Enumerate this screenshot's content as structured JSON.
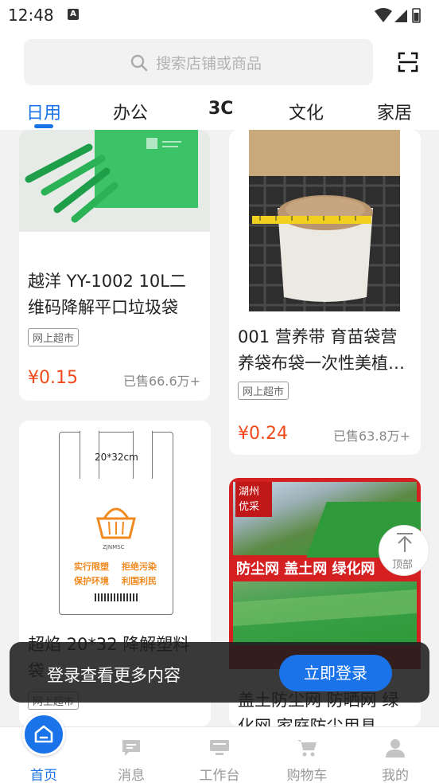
{
  "status": {
    "time": "12:48",
    "notification_letter": "A"
  },
  "search": {
    "placeholder": "搜索店铺或商品"
  },
  "tabs": [
    {
      "label": "日用",
      "active": true
    },
    {
      "label": "办公",
      "active": false
    },
    {
      "label": "3C",
      "active": false
    },
    {
      "label": "文化",
      "active": false
    },
    {
      "label": "家居",
      "active": false
    }
  ],
  "products": [
    {
      "title_line1": "越洋 YY-1002 10L二",
      "title_line2": "维码降解平口垃圾袋",
      "tag": "网上超市",
      "price": "¥0.15",
      "sold": "已售66.6万+"
    },
    {
      "title_line1": "001 营养带 育苗袋营",
      "title_line2": "养袋布袋一次性美植…",
      "tag": "网上超市",
      "price": "¥0.24",
      "sold": "已售63.8万+"
    },
    {
      "title_line1": "超焰 20*32 降解塑料",
      "title_line2": "袋",
      "tag": "网上超市",
      "image_text": {
        "size": "20*32cm",
        "brand": "ZJNMSC",
        "slogan1": "实行限塑",
        "slogan2": "拒绝污染",
        "slogan3": "保护环境",
        "slogan4": "利国利民"
      }
    },
    {
      "title_line1": "盖土防尘网 防晒网 绿",
      "title_line2": "化网 家庭防尘用具",
      "image_text": {
        "badge": "湖州优采",
        "banner": "防尘网  盖土网  绿化网"
      }
    }
  ],
  "back_to_top": {
    "label": "顶部"
  },
  "login_banner": {
    "text": "登录查看更多内容",
    "button": "立即登录"
  },
  "bottom_nav": [
    {
      "label": "首页",
      "icon": "home-icon",
      "active": true
    },
    {
      "label": "消息",
      "icon": "message-icon",
      "active": false
    },
    {
      "label": "工作台",
      "icon": "workbench-icon",
      "active": false
    },
    {
      "label": "购物车",
      "icon": "cart-icon",
      "active": false
    },
    {
      "label": "我的",
      "icon": "profile-icon",
      "active": false
    }
  ],
  "colors": {
    "accent": "#1a73e8",
    "price": "#f04a1a",
    "bag_green": "#3cc267",
    "net_green": "#2e9a3a",
    "banner_red": "#d42020"
  }
}
